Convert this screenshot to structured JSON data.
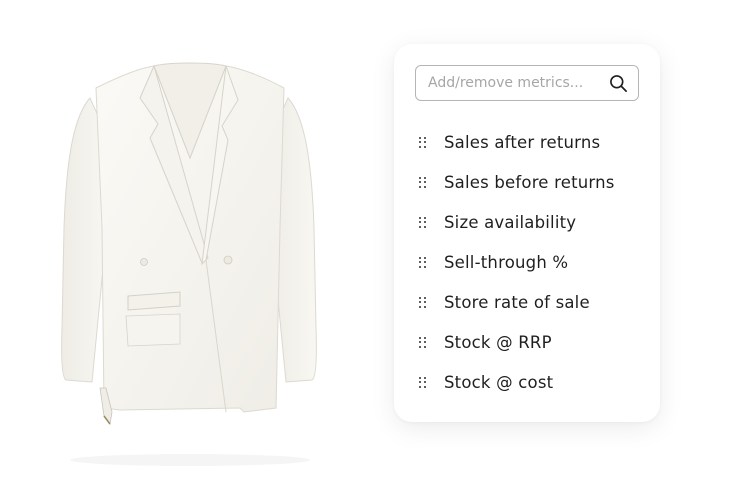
{
  "search": {
    "placeholder": "Add/remove metrics...",
    "icon": "search-icon"
  },
  "metrics": [
    {
      "label": "Sales after returns"
    },
    {
      "label": "Sales before returns"
    },
    {
      "label": "Size availability"
    },
    {
      "label": "Sell-through %"
    },
    {
      "label": "Store rate of sale"
    },
    {
      "label": "Stock @ RRP"
    },
    {
      "label": "Stock @ cost"
    }
  ],
  "colors": {
    "card_background": "#ffffff",
    "text": "#1f1f1f",
    "placeholder": "#a6a6a6",
    "search_border": "#b5b5b5",
    "garment": "#f7f5ef"
  },
  "icons": {
    "drag": "drag-handle-icon",
    "search": "search-icon",
    "product": "blazer-image"
  }
}
